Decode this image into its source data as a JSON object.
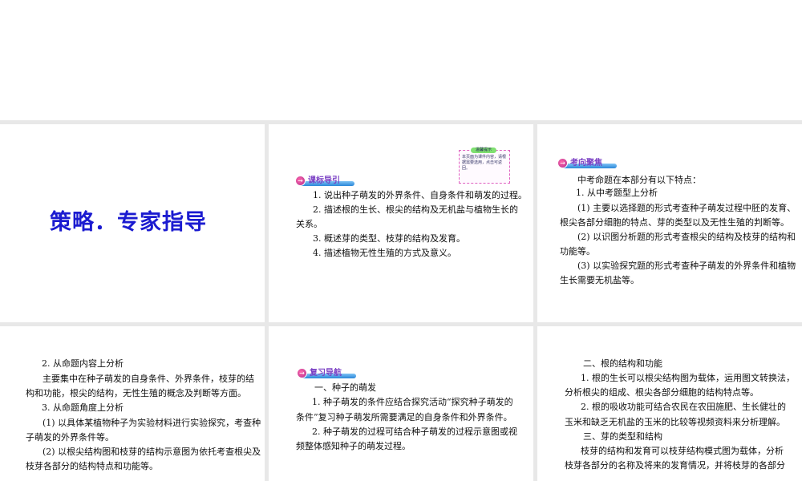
{
  "slides": [
    {
      "title": "策略．专家指导"
    },
    {
      "badge": "课标导引",
      "note": {
        "title": "温馨提示",
        "body": "本页面为课件内容，请根据需要选用，点击可返回。"
      },
      "lines": [
        "1. 说出种子萌发的外界条件、自身条件和萌发的过程。",
        "2. 描述根的生长、根尖的结构及无机盐与植物生长的",
        "关系。",
        "3. 概述芽的类型、枝芽的结构及发育。",
        "4. 描述植物无性生殖的方式及意义。"
      ]
    },
    {
      "badge": "考向聚焦",
      "lines": [
        "中考命题在本部分有以下特点：",
        "1. 从中考题型上分析",
        "(1) 主要以选择题的形式考查种子萌发过程中胚的发育、",
        "根尖各部分细胞的特点、芽的类型以及无性生殖的判断等。",
        "(2) 以识图分析题的形式考查根尖的结构及枝芽的结构和",
        "功能等。",
        "(3) 以实验探究题的形式考查种子萌发的外界条件和植物",
        "生长需要无机盐等。"
      ]
    },
    {
      "lines": [
        "2. 从命题内容上分析",
        "主要集中在种子萌发的自身条件、外界条件，枝芽的结",
        "构和功能，根尖的结构，无性生殖的概念及判断等方面。",
        "3. 从命题角度上分析",
        "(1) 以具体某植物种子为实验材料进行实验探究，考查种",
        "子萌发的外界条件等。",
        "(2) 以根尖结构图和枝芽的结构示意图为依托考查根尖及",
        "枝芽各部分的结构特点和功能等。"
      ]
    },
    {
      "badge": "复习导航",
      "lines": [
        "一、种子的萌发",
        "1. 种子萌发的条件应结合探究活动“探究种子萌发的",
        "条件”复习种子萌发所需要满足的自身条件和外界条件。",
        "2. 种子萌发的过程可结合种子萌发的过程示意图或视",
        "频整体感知种子的萌发过程。"
      ]
    },
    {
      "lines": [
        "二、根的结构和功能",
        "1. 根的生长可以根尖结构图为载体，运用图文转换法，",
        "分析根尖的组成、根尖各部分细胞的结构特点等。",
        "2. 根的吸收功能可结合农民在农田施肥、生长健壮的",
        "玉米和缺乏无机盐的玉米的比较等视频资料来分析理解。",
        "三、芽的类型和结构",
        "枝芽的结构和发育可以枝芽结构模式图为载体，分析",
        "枝芽各部分的名称及将来的发育情况，并将枝芽的各部分"
      ]
    }
  ]
}
